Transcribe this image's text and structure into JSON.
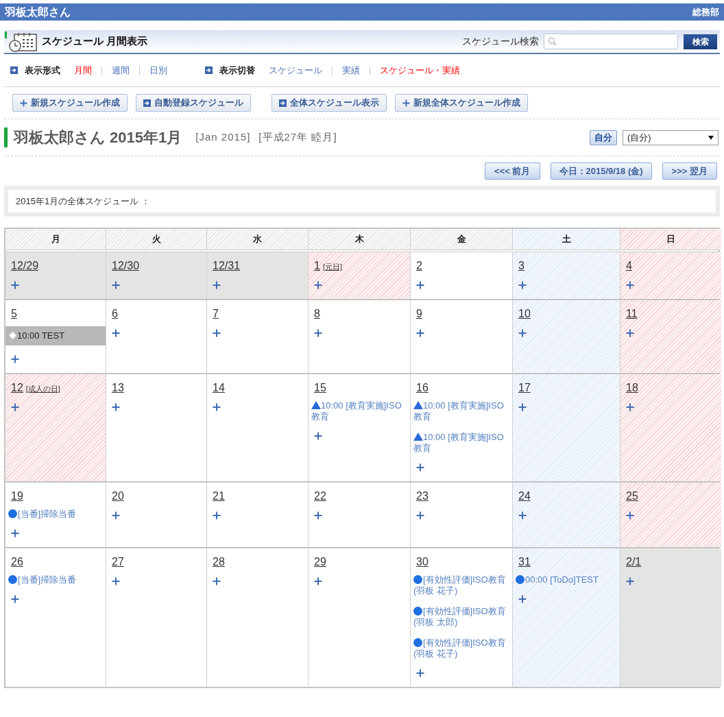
{
  "header": {
    "user": "羽板太郎さん",
    "department": "総務部"
  },
  "title_bar": {
    "title": "スケジュール 月間表示",
    "search_label": "スケジュール検索",
    "search_button": "検索"
  },
  "view_format": {
    "label": "表示形式",
    "options": [
      {
        "label": "月間",
        "selected": true
      },
      {
        "label": "週間",
        "selected": false
      },
      {
        "label": "日別",
        "selected": false
      }
    ]
  },
  "view_switch": {
    "label": "表示切替",
    "options": [
      {
        "label": "スケジュール",
        "selected": false
      },
      {
        "label": "実績",
        "selected": false
      },
      {
        "label": "スケジュール・実績",
        "selected": true
      }
    ]
  },
  "actions": [
    {
      "kind": "plus",
      "label": "新規スケジュール作成"
    },
    {
      "kind": "arrow",
      "label": "自動登録スケジュール"
    },
    {
      "kind": "arrow",
      "label": "全体スケジュール表示"
    },
    {
      "kind": "plus",
      "label": "新規全体スケジュール作成"
    }
  ],
  "heading": {
    "title": "羽板太郎さん 2015年1月",
    "western": "[Jan 2015]",
    "japanese": "[平成27年 睦月]",
    "self_button": "自分",
    "user_select": "(自分)"
  },
  "month_nav": {
    "prev": "<<< 前月",
    "today": "今日：2015/9/18 (金)",
    "next": ">>> 翌月"
  },
  "notice": "2015年1月の全体スケジュール ：",
  "calendar": {
    "weekdays": [
      {
        "label": "月",
        "kind": "weekday"
      },
      {
        "label": "火",
        "kind": "weekday"
      },
      {
        "label": "水",
        "kind": "weekday"
      },
      {
        "label": "木",
        "kind": "weekday"
      },
      {
        "label": "金",
        "kind": "weekday"
      },
      {
        "label": "土",
        "kind": "saturday"
      },
      {
        "label": "日",
        "kind": "sunday"
      }
    ],
    "weeks": [
      [
        {
          "date": "12/29",
          "kind": "other"
        },
        {
          "date": "12/30",
          "kind": "other"
        },
        {
          "date": "12/31",
          "kind": "other"
        },
        {
          "date": "1",
          "holiday": "[元日]",
          "kind": "holiday"
        },
        {
          "date": "2",
          "kind": "weekday"
        },
        {
          "date": "3",
          "kind": "saturday"
        },
        {
          "date": "4",
          "kind": "holiday"
        }
      ],
      [
        {
          "date": "5",
          "kind": "weekday",
          "events": [
            {
              "kind": "diamond",
              "text": "10:00 TEST"
            }
          ]
        },
        {
          "date": "6",
          "kind": "weekday"
        },
        {
          "date": "7",
          "kind": "weekday"
        },
        {
          "date": "8",
          "kind": "weekday"
        },
        {
          "date": "9",
          "kind": "weekday"
        },
        {
          "date": "10",
          "kind": "saturday"
        },
        {
          "date": "11",
          "kind": "holiday"
        }
      ],
      [
        {
          "date": "12",
          "holiday": "[成人の日]",
          "kind": "holiday"
        },
        {
          "date": "13",
          "kind": "weekday"
        },
        {
          "date": "14",
          "kind": "weekday"
        },
        {
          "date": "15",
          "kind": "weekday",
          "events": [
            {
              "kind": "triangle",
              "text": "10:00 [教育実施]ISO教育"
            }
          ]
        },
        {
          "date": "16",
          "kind": "weekday",
          "events": [
            {
              "kind": "triangle",
              "text": "10:00 [教育実施]ISO教育"
            },
            {
              "kind": "triangle",
              "text": "10:00 [教育実施]ISO教育"
            }
          ]
        },
        {
          "date": "17",
          "kind": "saturday"
        },
        {
          "date": "18",
          "kind": "holiday"
        }
      ],
      [
        {
          "date": "19",
          "kind": "weekday",
          "events": [
            {
              "kind": "circle",
              "text": "[当番]掃除当番"
            }
          ]
        },
        {
          "date": "20",
          "kind": "weekday"
        },
        {
          "date": "21",
          "kind": "weekday"
        },
        {
          "date": "22",
          "kind": "weekday"
        },
        {
          "date": "23",
          "kind": "weekday"
        },
        {
          "date": "24",
          "kind": "saturday"
        },
        {
          "date": "25",
          "kind": "holiday"
        }
      ],
      [
        {
          "date": "26",
          "kind": "weekday",
          "events": [
            {
              "kind": "circle",
              "text": "[当番]掃除当番"
            }
          ]
        },
        {
          "date": "27",
          "kind": "weekday"
        },
        {
          "date": "28",
          "kind": "weekday"
        },
        {
          "date": "29",
          "kind": "weekday"
        },
        {
          "date": "30",
          "kind": "weekday",
          "events": [
            {
              "kind": "circle",
              "text": "[有効性評価]ISO教育(羽板 花子)"
            },
            {
              "kind": "circle",
              "text": "[有効性評価]ISO教育(羽板 太郎)"
            },
            {
              "kind": "circle",
              "text": "[有効性評価]ISO教育(羽板 花子)"
            }
          ]
        },
        {
          "date": "31",
          "kind": "saturday",
          "events": [
            {
              "kind": "circle",
              "text": "00:00 [ToDo]TEST"
            }
          ]
        },
        {
          "date": "2/1",
          "kind": "other"
        }
      ]
    ]
  }
}
